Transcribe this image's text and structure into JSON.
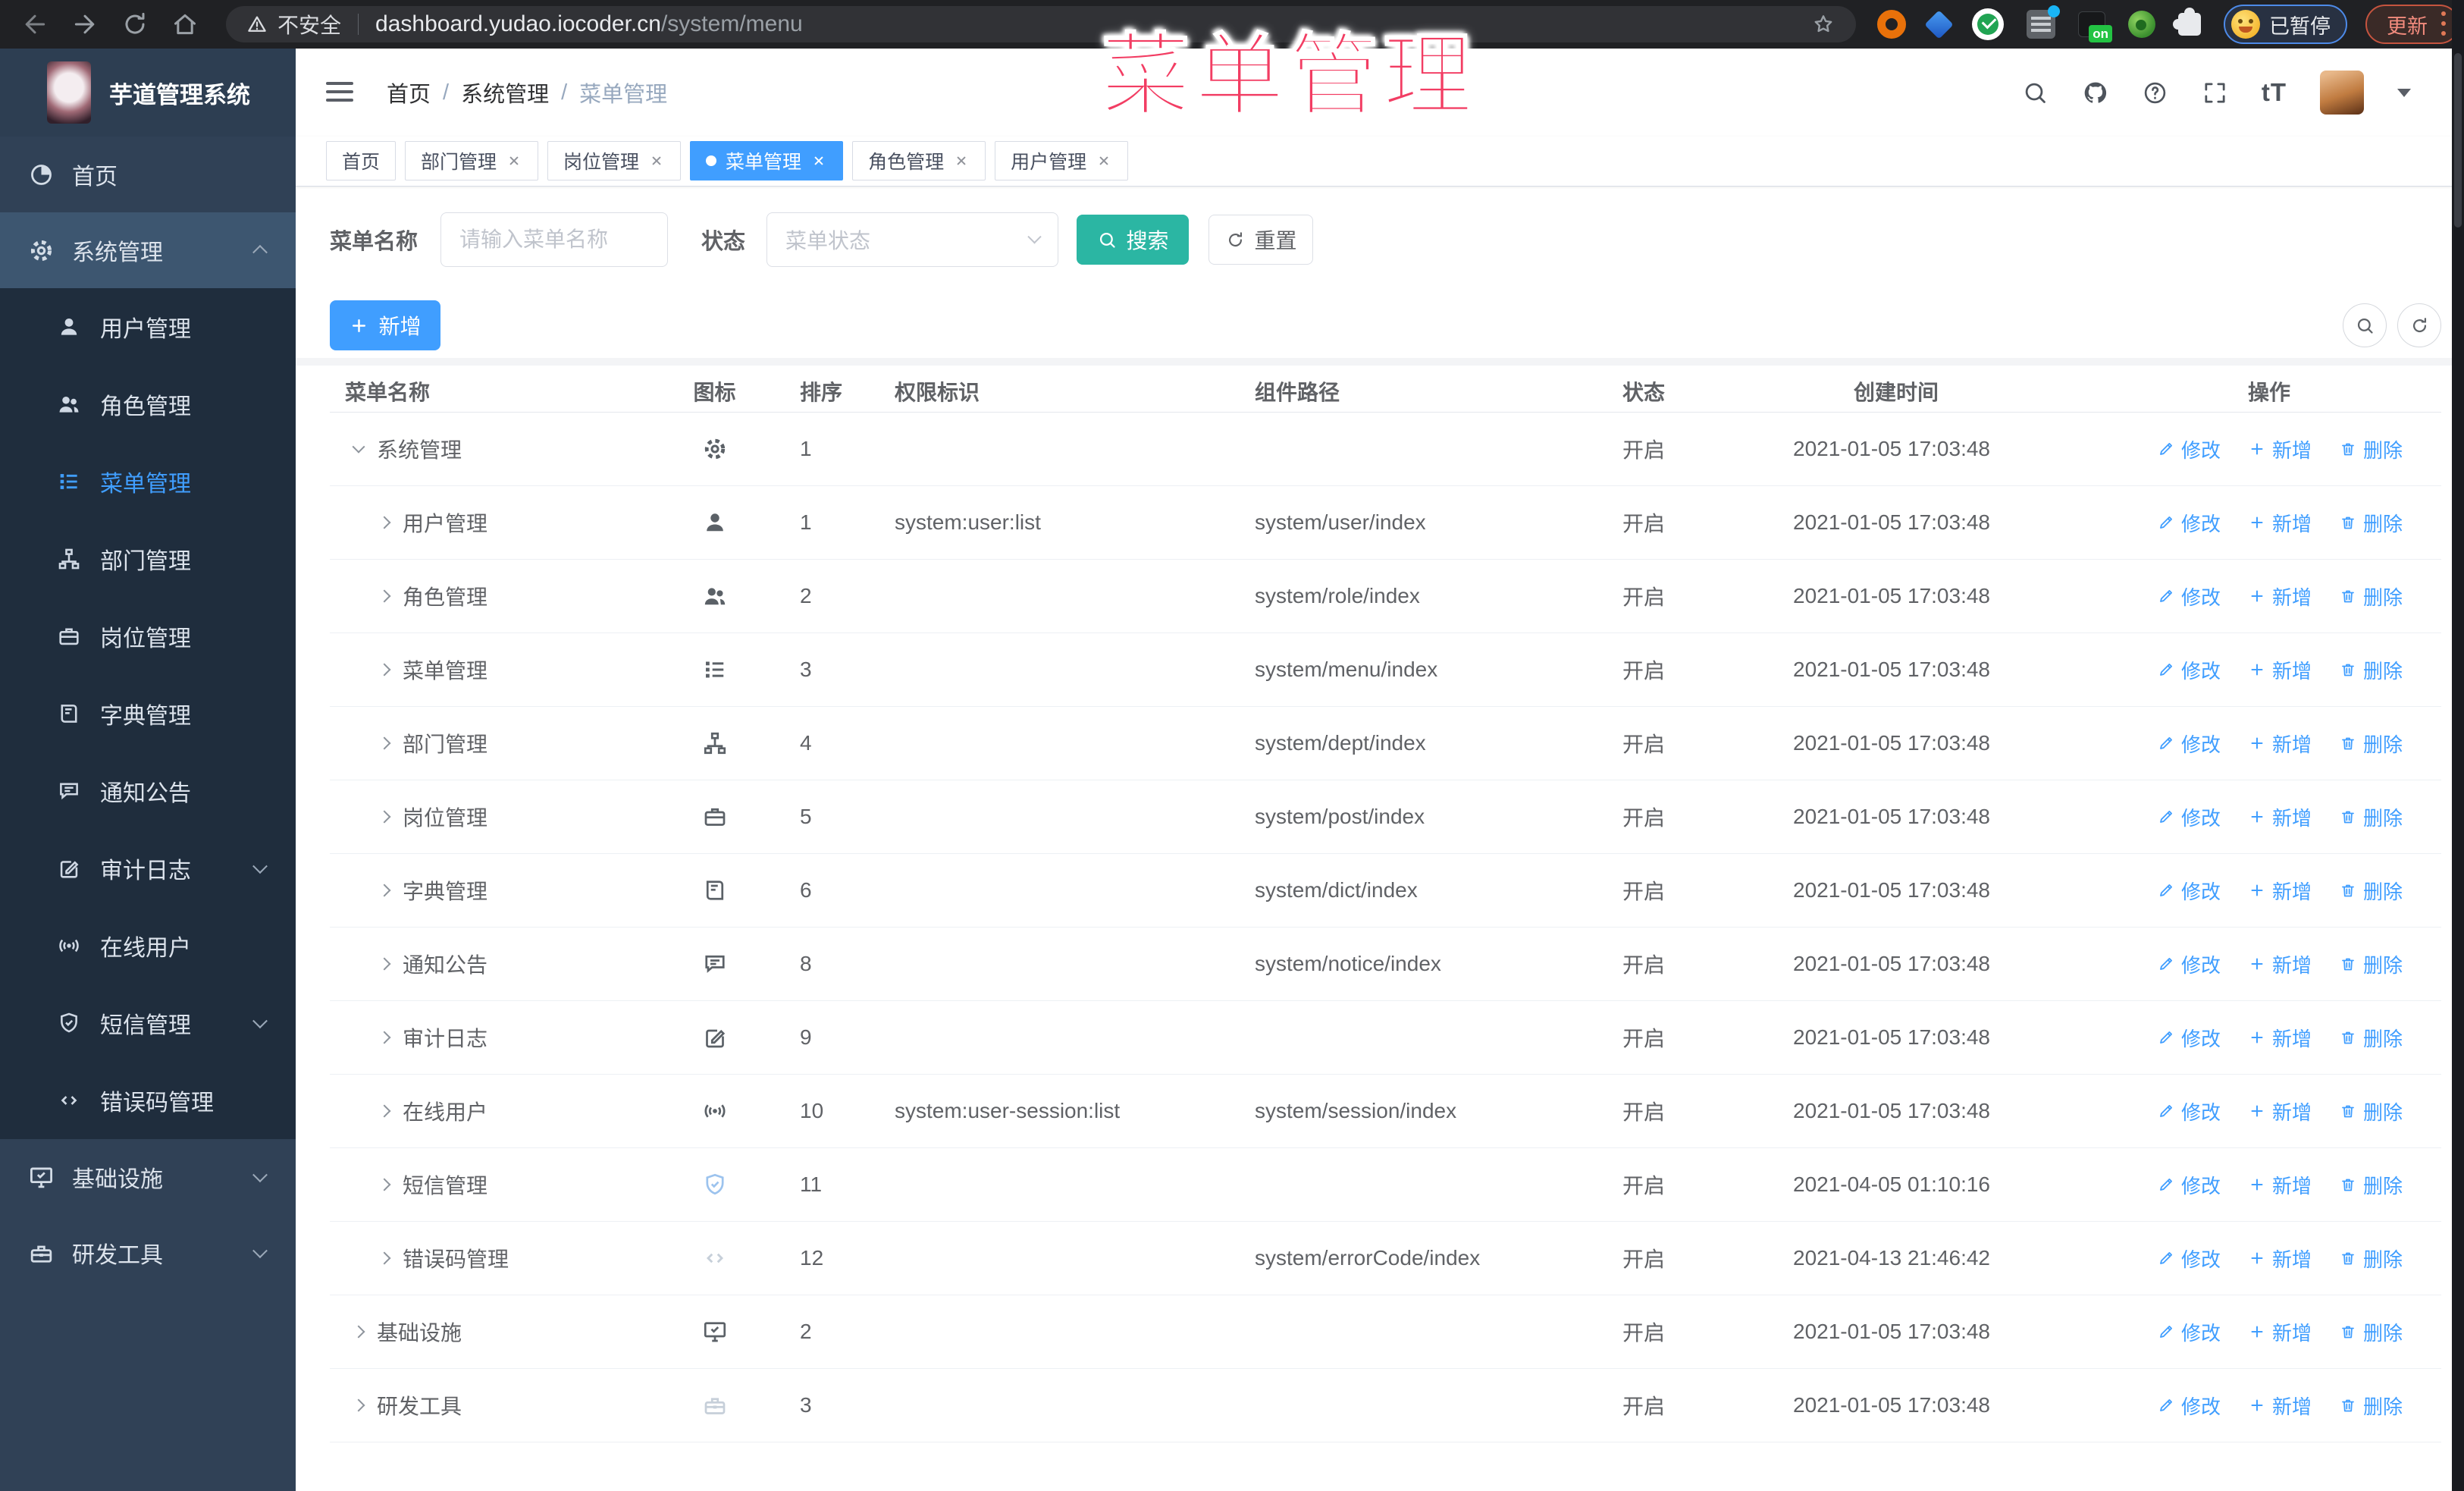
{
  "browser": {
    "security_label": "不安全",
    "url_host": "dashboard.yudao.iocoder.cn",
    "url_path": "/system/menu",
    "extension_on_badge": "on",
    "paused_badge": "已暂停",
    "update_button": "更新"
  },
  "watermark": "菜单管理",
  "sidebar": {
    "logo_title": "芋道管理系统",
    "items": [
      {
        "icon": "dashboard",
        "label": "首页",
        "top": true
      },
      {
        "icon": "gear",
        "label": "系统管理",
        "top": true,
        "open": true,
        "arrow_up": true
      },
      {
        "icon": "user",
        "label": "用户管理",
        "sub": true
      },
      {
        "icon": "users",
        "label": "角色管理",
        "sub": true
      },
      {
        "icon": "menu",
        "label": "菜单管理",
        "sub": true,
        "active": true
      },
      {
        "icon": "tree",
        "label": "部门管理",
        "sub": true
      },
      {
        "icon": "suitcase",
        "label": "岗位管理",
        "sub": true
      },
      {
        "icon": "book",
        "label": "字典管理",
        "sub": true
      },
      {
        "icon": "message",
        "label": "通知公告",
        "sub": true
      },
      {
        "icon": "edit",
        "label": "审计日志",
        "sub": true,
        "arrow_down": true
      },
      {
        "icon": "online",
        "label": "在线用户",
        "sub": true
      },
      {
        "icon": "shield",
        "label": "短信管理",
        "sub": true,
        "arrow_down": true
      },
      {
        "icon": "code",
        "label": "错误码管理",
        "sub": true
      },
      {
        "icon": "monitor",
        "label": "基础设施",
        "top": true,
        "arrow_down": true
      },
      {
        "icon": "toolbox",
        "label": "研发工具",
        "top": true,
        "arrow_down": true
      }
    ]
  },
  "header": {
    "breadcrumb": [
      "首页",
      "系统管理",
      "菜单管理"
    ],
    "breadcrumb_sep": "/",
    "font_icon": "tT"
  },
  "tabs": [
    {
      "label": "首页",
      "closable": false
    },
    {
      "label": "部门管理",
      "closable": true
    },
    {
      "label": "岗位管理",
      "closable": true
    },
    {
      "label": "菜单管理",
      "closable": true,
      "active": true
    },
    {
      "label": "角色管理",
      "closable": true
    },
    {
      "label": "用户管理",
      "closable": true
    }
  ],
  "search": {
    "name_label": "菜单名称",
    "name_placeholder": "请输入菜单名称",
    "name_value": "",
    "status_label": "状态",
    "status_placeholder": "菜单状态",
    "search_button": "搜索",
    "reset_button": "重置"
  },
  "toolbar": {
    "add_button": "新增"
  },
  "table": {
    "columns": [
      "菜单名称",
      "图标",
      "排序",
      "权限标识",
      "组件路径",
      "状态",
      "创建时间",
      "操作"
    ],
    "actions": {
      "edit": "修改",
      "add": "新增",
      "delete": "删除"
    },
    "rows": [
      {
        "name": "系统管理",
        "icon": "gear",
        "expanded": true,
        "sort": "1",
        "perm": "",
        "path": "",
        "status": "开启",
        "time": "2021-01-05 17:03:48"
      },
      {
        "name": "用户管理",
        "icon": "user",
        "lvl1": true,
        "sort": "1",
        "perm": "system:user:list",
        "path": "system/user/index",
        "status": "开启",
        "time": "2021-01-05 17:03:48"
      },
      {
        "name": "角色管理",
        "icon": "users",
        "lvl1": true,
        "sort": "2",
        "perm": "",
        "path": "system/role/index",
        "status": "开启",
        "time": "2021-01-05 17:03:48"
      },
      {
        "name": "菜单管理",
        "icon": "menu",
        "lvl1": true,
        "sort": "3",
        "perm": "",
        "path": "system/menu/index",
        "status": "开启",
        "time": "2021-01-05 17:03:48"
      },
      {
        "name": "部门管理",
        "icon": "tree",
        "lvl1": true,
        "sort": "4",
        "perm": "",
        "path": "system/dept/index",
        "status": "开启",
        "time": "2021-01-05 17:03:48"
      },
      {
        "name": "岗位管理",
        "icon": "suitcase",
        "lvl1": true,
        "sort": "5",
        "perm": "",
        "path": "system/post/index",
        "status": "开启",
        "time": "2021-01-05 17:03:48"
      },
      {
        "name": "字典管理",
        "icon": "book",
        "lvl1": true,
        "sort": "6",
        "perm": "",
        "path": "system/dict/index",
        "status": "开启",
        "time": "2021-01-05 17:03:48"
      },
      {
        "name": "通知公告",
        "icon": "message",
        "lvl1": true,
        "sort": "8",
        "perm": "",
        "path": "system/notice/index",
        "status": "开启",
        "time": "2021-01-05 17:03:48"
      },
      {
        "name": "审计日志",
        "icon": "edit",
        "lvl1": true,
        "sort": "9",
        "perm": "",
        "path": "",
        "status": "开启",
        "time": "2021-01-05 17:03:48"
      },
      {
        "name": "在线用户",
        "icon": "online",
        "lvl1": true,
        "sort": "10",
        "perm": "system:user-session:list",
        "path": "system/session/index",
        "status": "开启",
        "time": "2021-01-05 17:03:48"
      },
      {
        "name": "短信管理",
        "icon": "shield",
        "lvl1": true,
        "icon_blue": true,
        "sort": "11",
        "perm": "",
        "path": "",
        "status": "开启",
        "time": "2021-04-05 01:10:16"
      },
      {
        "name": "错误码管理",
        "icon": "code",
        "lvl1": true,
        "icon_faint": true,
        "sort": "12",
        "perm": "",
        "path": "system/errorCode/index",
        "status": "开启",
        "time": "2021-04-13 21:46:42"
      },
      {
        "name": "基础设施",
        "icon": "monitor",
        "sort": "2",
        "perm": "",
        "path": "",
        "status": "开启",
        "time": "2021-01-05 17:03:48"
      },
      {
        "name": "研发工具",
        "icon": "toolbox",
        "icon_faint": true,
        "sort": "3",
        "perm": "",
        "path": "",
        "status": "开启",
        "time": "2021-01-05 17:03:48"
      }
    ]
  },
  "colors": {
    "accent_blue": "#409eff",
    "search_teal": "#2bb6a3",
    "sidebar_bg": "#304156",
    "submenu_bg": "#1f2d3d",
    "watermark_pink": "#f23d63",
    "browser_bar": "#202124"
  }
}
